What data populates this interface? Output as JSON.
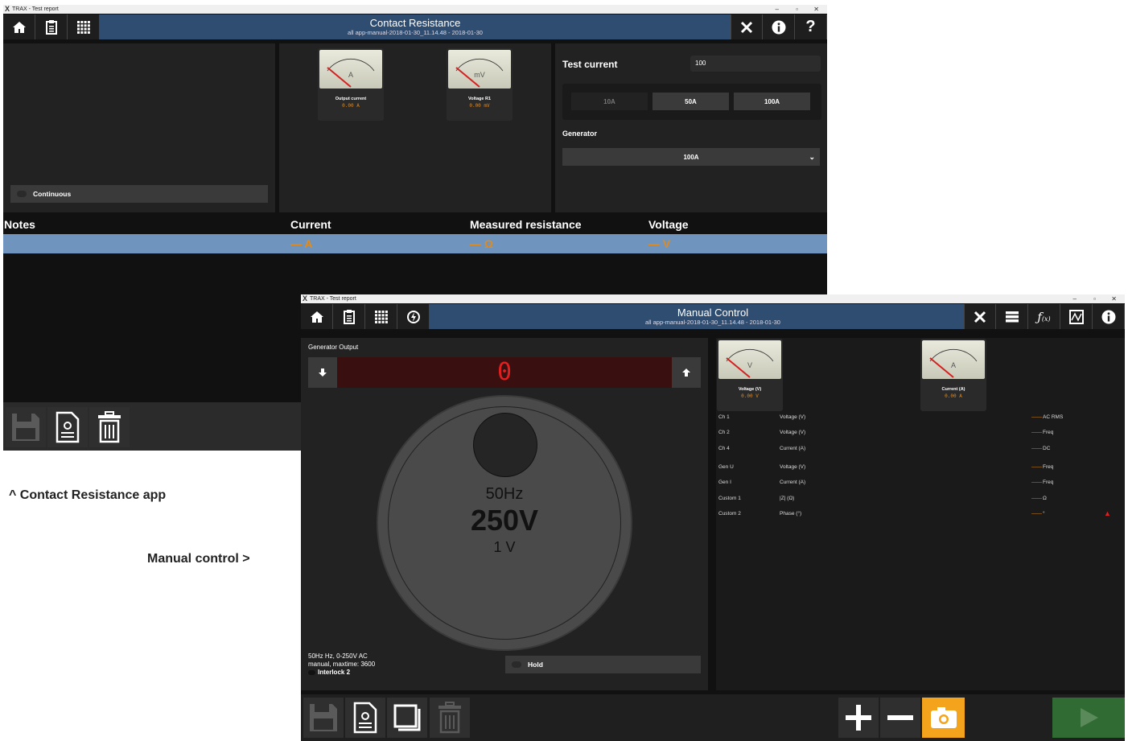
{
  "contact_window": {
    "os_title": "TRAX - Test report",
    "title": "Contact Resistance",
    "subtitle": "all app-manual-2018-01-30_11.14.48 - 2018-01-30",
    "meters": [
      {
        "unit": "A",
        "caption": "Output current",
        "value": "0.00 A"
      },
      {
        "unit": "mV",
        "caption": "Voltage R1",
        "value": "0.00 mV"
      }
    ],
    "continuous_label": "Continuous",
    "test_current_label": "Test current",
    "test_current_value": "100",
    "range_buttons": [
      "10A",
      "50A",
      "100A"
    ],
    "generator_label": "Generator",
    "generator_value": "100A",
    "table_headers": [
      "Notes",
      "Current",
      "Measured resistance",
      "Voltage"
    ],
    "table_row": [
      "",
      "— A",
      "— Ω",
      "— V"
    ]
  },
  "captions": {
    "contact": "^ Contact Resistance app",
    "manual": "Manual control >"
  },
  "manual_window": {
    "os_title": "TRAX - Test report",
    "title": "Manual Control",
    "subtitle": "all app-manual-2018-01-30_11.14.48 - 2018-01-30",
    "generator_output_label": "Generator Output",
    "display_value": "0",
    "knob_freq": "50Hz",
    "knob_voltage": "250V",
    "knob_step": "1 V",
    "info_line1": "50Hz Hz, 0-250V AC",
    "info_line2": "manual, maxtime: 3600",
    "interlock_label": "Interlock 2",
    "hold_label": "Hold",
    "meters": [
      {
        "unit": "V",
        "caption": "Voltage (V)",
        "value": "0.00 V"
      },
      {
        "unit": "A",
        "caption": "Current (A)",
        "value": "0.00 A"
      }
    ],
    "measurements": [
      {
        "channel": "Ch 1",
        "quantity": "Voltage (V)",
        "value": "——",
        "mode": "AC RMS"
      },
      {
        "channel": "Ch 2",
        "quantity": "Voltage (V)",
        "value": "——",
        "mode": "Freq"
      },
      {
        "channel": "Ch 4",
        "quantity": "Current (A)",
        "value": "——",
        "mode": "DC"
      },
      {
        "channel": "Gen U",
        "quantity": "Voltage (V)",
        "value": "——",
        "mode": "Freq"
      },
      {
        "channel": "Gen I",
        "quantity": "Current (A)",
        "value": "——",
        "mode": "Freq"
      },
      {
        "channel": "Custom 1",
        "quantity": "|Z| (Ω)",
        "value": "——",
        "mode": "Ω"
      },
      {
        "channel": "Custom 2",
        "quantity": "Phase (°)",
        "value": "——",
        "mode": "°"
      }
    ]
  },
  "colors": {
    "appbar": "#2e4d70",
    "accent_orange": "#e38a1c",
    "play_green": "#2f6b32",
    "selected_row": "#6f95be"
  }
}
